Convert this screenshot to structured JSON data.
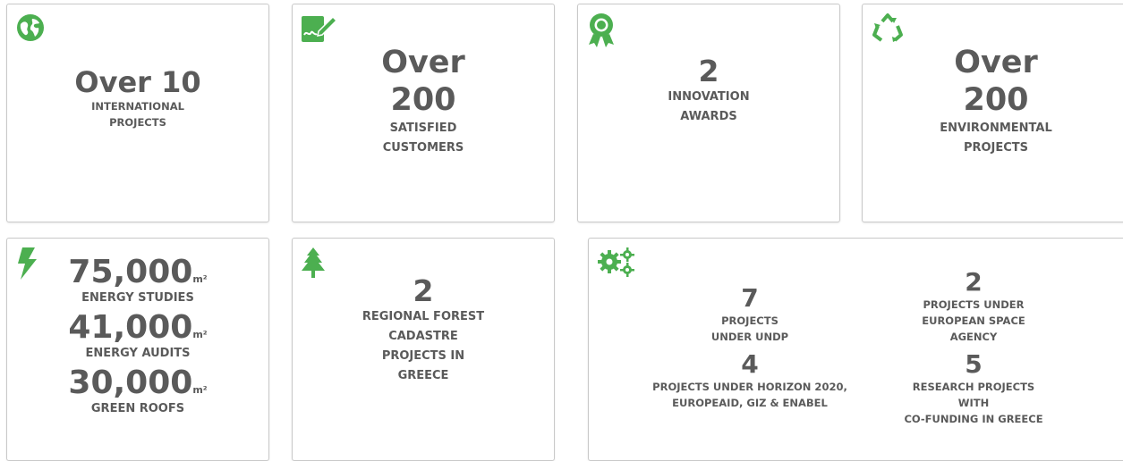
{
  "accent": "#4caf50",
  "cards": {
    "international": {
      "icon": "globe-icon",
      "value": "Over 10",
      "label_1": "INTERNATIONAL",
      "label_2": "PROJECTS"
    },
    "customers": {
      "icon": "signature-icon",
      "value_1": "Over",
      "value_2": "200",
      "label_1": "SATISFIED",
      "label_2": "CUSTOMERS"
    },
    "awards": {
      "icon": "award-icon",
      "value": "2",
      "label_1": "INNOVATION",
      "label_2": "AWARDS"
    },
    "environmental": {
      "icon": "recycle-icon",
      "value_1": "Over",
      "value_2": "200",
      "label_1": "ENVIRONMENTAL",
      "label_2": "PROJECTS"
    },
    "energy": {
      "icon": "lightning-icon",
      "items": [
        {
          "value": "75,000",
          "unit": "m²",
          "label": "ENERGY STUDIES"
        },
        {
          "value": "41,000",
          "unit": "m²",
          "label": "ENERGY AUDITS"
        },
        {
          "value": "30,000",
          "unit": "m²",
          "label": "GREEN ROOFS"
        }
      ]
    },
    "forest": {
      "icon": "tree-icon",
      "value": "2",
      "label_1": "REGIONAL FOREST",
      "label_2": "CADASTRE",
      "label_3": "PROJECTS IN",
      "label_4": "GREECE"
    },
    "research": {
      "icon": "gears-icon",
      "undp": {
        "value": "7",
        "label_1": "PROJECTS",
        "label_2": "UNDER UNDP"
      },
      "esa": {
        "value": "2",
        "label_1": "PROJECTS UNDER",
        "label_2": "EUROPEAN SPACE",
        "label_3": "AGENCY"
      },
      "horizon": {
        "value": "4",
        "label_1": "PROJECTS UNDER HORIZON 2020,",
        "label_2": "EUROPEAID, GIZ & ENABEL"
      },
      "cofunding": {
        "value": "5",
        "label_1": "RESEARCH PROJECTS",
        "label_2": "WITH",
        "label_3": "CO-FUNDING IN GREECE"
      }
    }
  }
}
